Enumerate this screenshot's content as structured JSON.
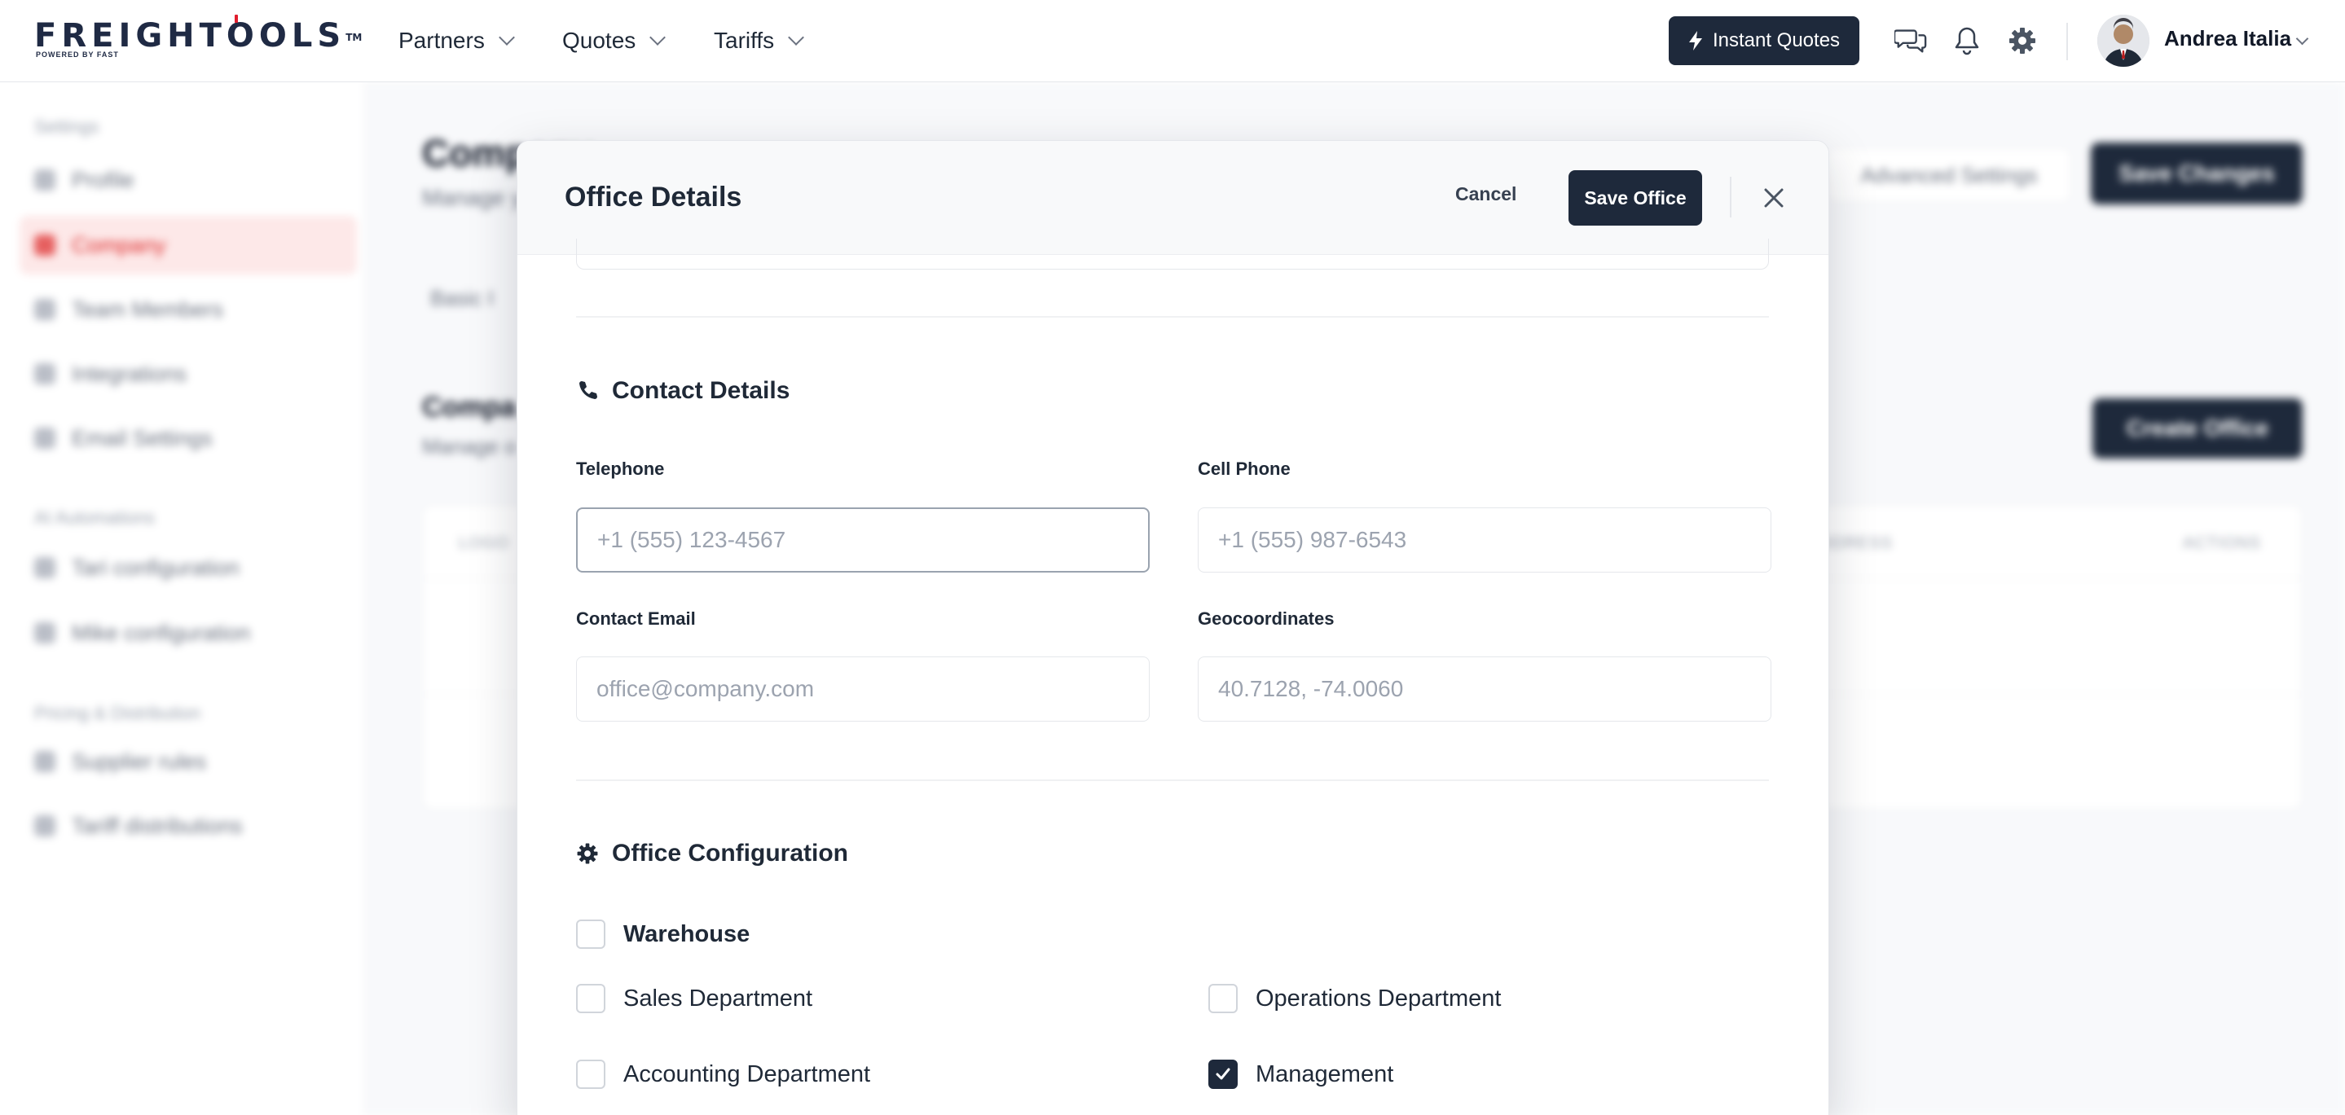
{
  "brand": {
    "name": "FREIGHTOOLS",
    "tm": "TM",
    "tagline": "POWERED BY FAST"
  },
  "nav": [
    {
      "label": "Partners"
    },
    {
      "label": "Quotes"
    },
    {
      "label": "Tariffs"
    }
  ],
  "header": {
    "instant_quotes": "Instant Quotes",
    "user_name": "Andrea Italia"
  },
  "background": {
    "sidebar": {
      "sections": [
        "Settings",
        "AI Automations",
        "Pricing & Distribution"
      ],
      "items": [
        {
          "label": "Profile"
        },
        {
          "label": "Company",
          "active": true
        },
        {
          "label": "Team Members"
        },
        {
          "label": "Integrations"
        },
        {
          "label": "Email Settings"
        },
        {
          "label": "Tari configuration"
        },
        {
          "label": "Mike configuration"
        },
        {
          "label": "Supplier rules"
        },
        {
          "label": "Tariff distributions"
        }
      ]
    },
    "page": {
      "title": "Company",
      "subtitle": "Manage y",
      "advanced_settings": "Advanced Settings",
      "save_changes": "Save Changes",
      "basic_tab": "Basic I",
      "offices_title": "Compa",
      "offices_subtitle": "Manage o",
      "create_office": "Create Office",
      "table_headers": [
        "LOGO",
        "ADDRESS",
        "ACTIONS"
      ]
    }
  },
  "modal": {
    "title": "Office Details",
    "cancel": "Cancel",
    "save": "Save Office",
    "contact_section": {
      "title": "Contact Details",
      "telephone": {
        "label": "Telephone",
        "placeholder": "+1 (555) 123-4567"
      },
      "cell_phone": {
        "label": "Cell Phone",
        "placeholder": "+1 (555) 987-6543"
      },
      "contact_email": {
        "label": "Contact Email",
        "placeholder": "office@company.com"
      },
      "geocoordinates": {
        "label": "Geocoordinates",
        "placeholder": "40.7128, -74.0060"
      }
    },
    "config_section": {
      "title": "Office Configuration",
      "warehouse": {
        "label": "Warehouse",
        "checked": false
      },
      "sales": {
        "label": "Sales Department",
        "checked": false
      },
      "operations": {
        "label": "Operations Department",
        "checked": false
      },
      "accounting": {
        "label": "Accounting Department",
        "checked": false
      },
      "management": {
        "label": "Management",
        "checked": true
      }
    }
  }
}
